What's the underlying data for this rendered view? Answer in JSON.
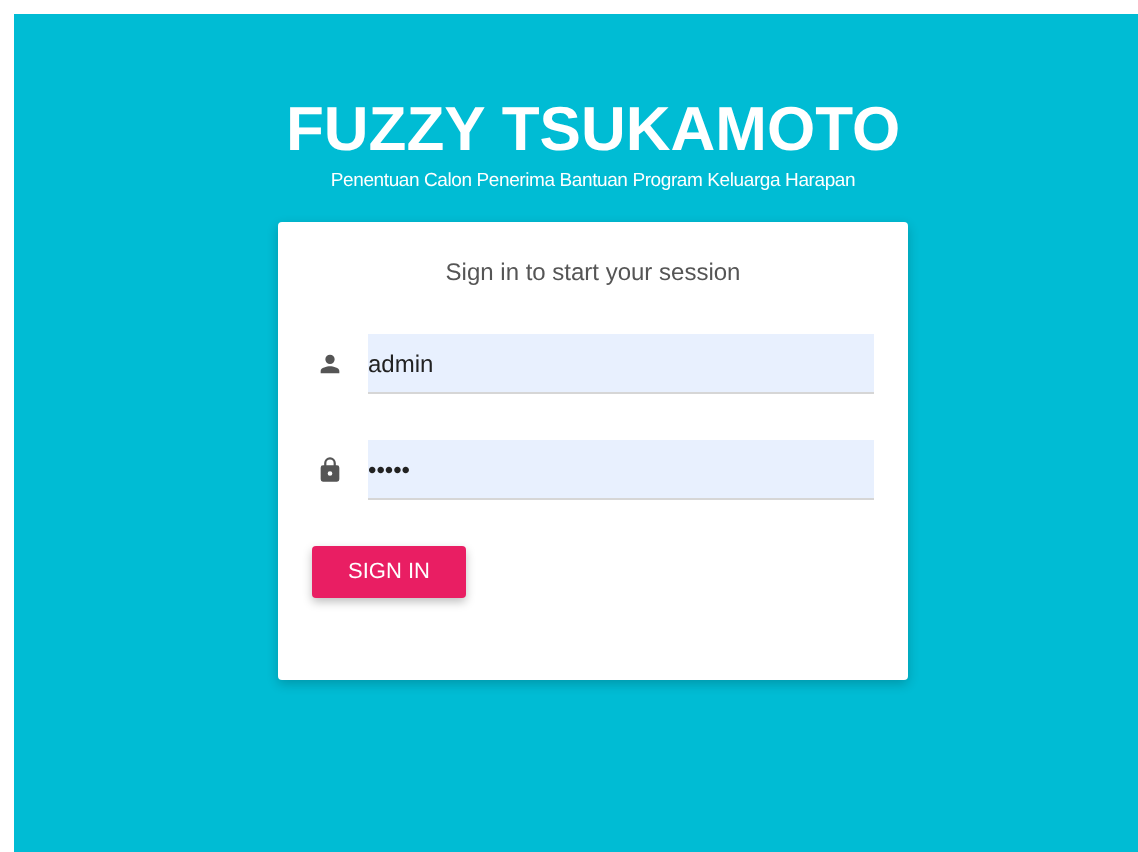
{
  "app": {
    "title": "FUZZY TSUKAMOTO",
    "subtitle": "Penentuan Calon Penerima Bantuan Program Keluarga Harapan"
  },
  "login": {
    "heading": "Sign in to start your session",
    "fields": [
      {
        "kind": "user",
        "value": "admin"
      },
      {
        "kind": "password",
        "value": "•••••"
      }
    ],
    "button": "SIGN IN"
  }
}
